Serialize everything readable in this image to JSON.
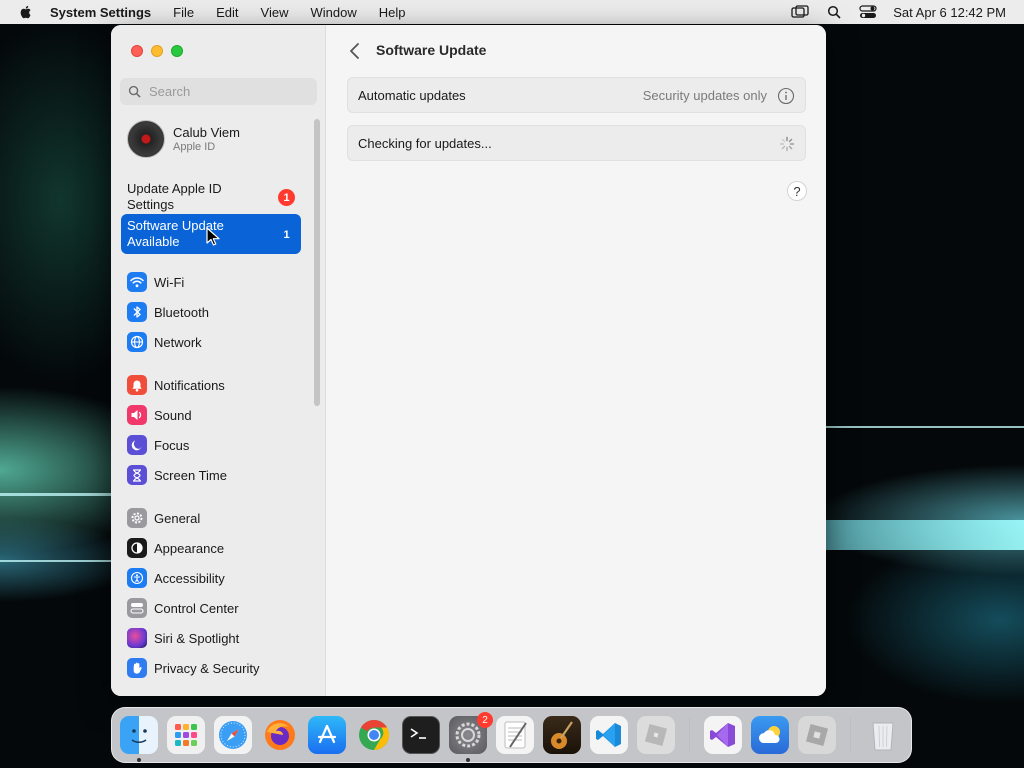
{
  "menubar": {
    "app_name": "System Settings",
    "menus": [
      "File",
      "Edit",
      "View",
      "Window",
      "Help"
    ],
    "clock": "Sat Apr 6  12:42 PM"
  },
  "sidebar": {
    "search_placeholder": "Search",
    "account": {
      "name": "Calub Viem",
      "subtitle": "Apple ID"
    },
    "notices": [
      {
        "label": "Update Apple ID Settings",
        "badge": "1",
        "selected": false
      },
      {
        "label": "Software Update Available",
        "badge": "1",
        "selected": true
      }
    ],
    "groups": [
      [
        {
          "label": "Wi-Fi",
          "icon": "wifi-icon",
          "color": "#1e7cf2"
        },
        {
          "label": "Bluetooth",
          "icon": "bluetooth-icon",
          "color": "#1e7cf2"
        },
        {
          "label": "Network",
          "icon": "globe-icon",
          "color": "#1e7cf2"
        }
      ],
      [
        {
          "label": "Notifications",
          "icon": "bell-icon",
          "color": "#f04d3a"
        },
        {
          "label": "Sound",
          "icon": "speaker-icon",
          "color": "#f0396a"
        },
        {
          "label": "Focus",
          "icon": "moon-icon",
          "color": "#5b4fd6"
        },
        {
          "label": "Screen Time",
          "icon": "hourglass-icon",
          "color": "#5b4fd6"
        }
      ],
      [
        {
          "label": "General",
          "icon": "gear-icon",
          "color": "#9a9a9e"
        },
        {
          "label": "Appearance",
          "icon": "appearance-icon",
          "color": "#1a1a1a"
        },
        {
          "label": "Accessibility",
          "icon": "accessibility-icon",
          "color": "#1e7cf2"
        },
        {
          "label": "Control Center",
          "icon": "control-center-icon",
          "color": "#9a9a9e"
        },
        {
          "label": "Siri & Spotlight",
          "icon": "siri-icon",
          "color": "#7a3ad6"
        },
        {
          "label": "Privacy & Security",
          "icon": "hand-icon",
          "color": "#2f7cf0"
        }
      ]
    ]
  },
  "main": {
    "title": "Software Update",
    "rows": [
      {
        "label": "Automatic updates",
        "value": "Security updates only",
        "trailing": "info-icon"
      },
      {
        "label": "Checking for updates...",
        "value": "",
        "trailing": "spinner-icon"
      }
    ],
    "help": "?"
  },
  "dock": {
    "apps": [
      {
        "name": "Finder",
        "icon": "finder-icon",
        "running": true
      },
      {
        "name": "Launchpad",
        "icon": "launchpad-icon",
        "running": false
      },
      {
        "name": "Safari",
        "icon": "safari-icon",
        "running": false
      },
      {
        "name": "Firefox",
        "icon": "firefox-icon",
        "running": false
      },
      {
        "name": "App Store",
        "icon": "app-store-icon",
        "running": false
      },
      {
        "name": "Chrome",
        "icon": "chrome-icon",
        "running": false
      },
      {
        "name": "Terminal",
        "icon": "terminal-icon",
        "running": false
      },
      {
        "name": "System Settings",
        "icon": "system-settings-icon",
        "running": true,
        "badge": "2"
      },
      {
        "name": "Script Editor",
        "icon": "script-editor-icon",
        "running": false
      },
      {
        "name": "GarageBand",
        "icon": "guitar-icon",
        "running": false
      },
      {
        "name": "Visual Studio Code",
        "icon": "vscode-icon",
        "running": false
      },
      {
        "name": "Roblox",
        "icon": "roblox-icon",
        "running": false
      },
      {
        "name": "Visual Studio",
        "icon": "visual-studio-icon",
        "running": false
      },
      {
        "name": "Weather",
        "icon": "weather-icon",
        "running": false
      },
      {
        "name": "Roblox Studio",
        "icon": "roblox-studio-icon",
        "running": false
      },
      {
        "name": "Trash",
        "icon": "trash-icon",
        "running": false
      }
    ]
  }
}
